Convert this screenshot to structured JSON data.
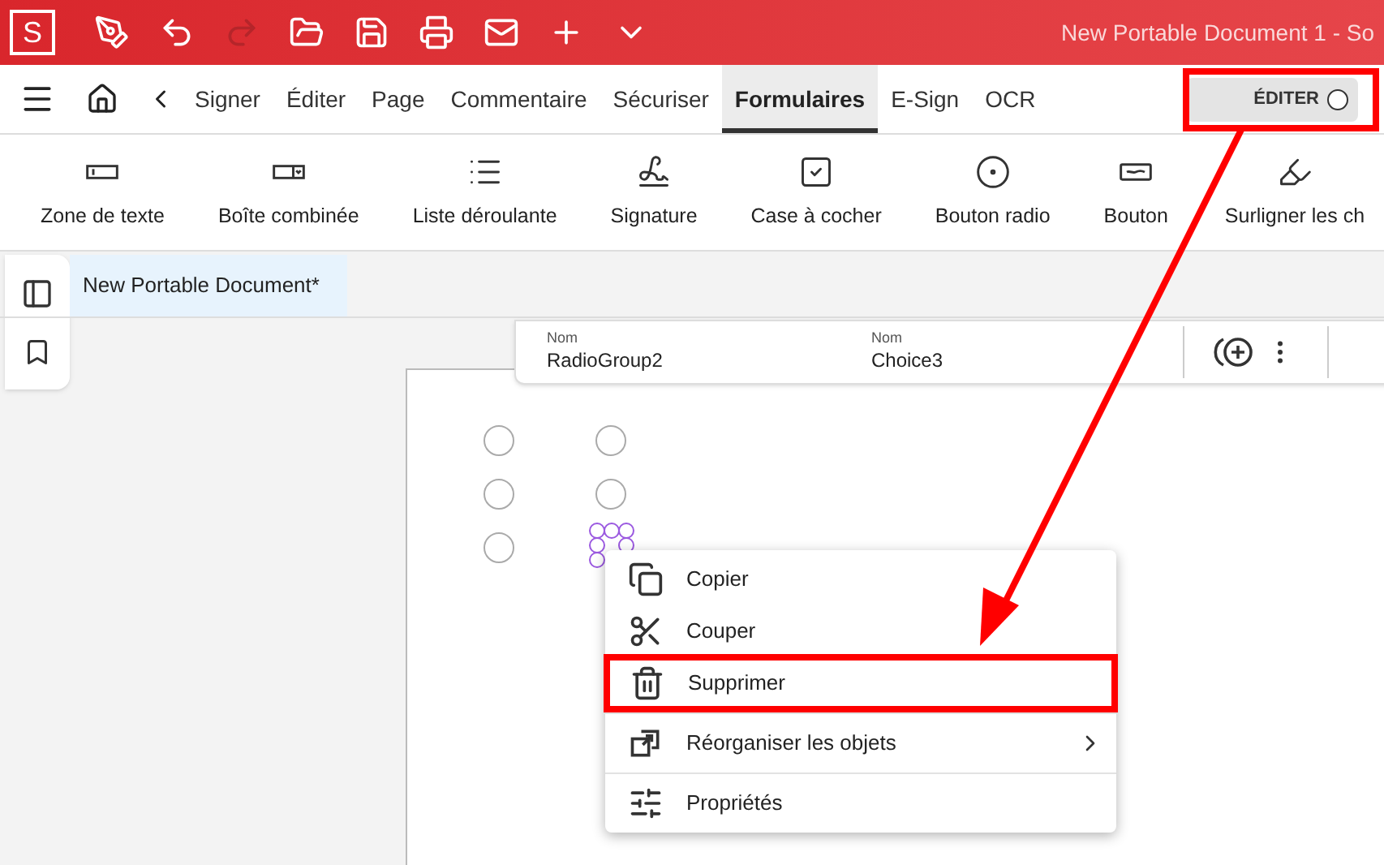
{
  "app": {
    "logo": "S",
    "title": "New Portable Document 1  -  So"
  },
  "quick_toolbar": [
    {
      "kind": "pen",
      "disabled": false
    },
    {
      "kind": "undo",
      "disabled": false
    },
    {
      "kind": "redo",
      "disabled": true
    },
    {
      "kind": "open",
      "disabled": false
    },
    {
      "kind": "save",
      "disabled": false
    },
    {
      "kind": "print",
      "disabled": false
    },
    {
      "kind": "mail",
      "disabled": false
    },
    {
      "kind": "add",
      "disabled": false
    },
    {
      "kind": "more",
      "disabled": false
    }
  ],
  "tabs": [
    {
      "label": "Signer",
      "selected": false
    },
    {
      "label": "Éditer",
      "selected": false
    },
    {
      "label": "Page",
      "selected": false
    },
    {
      "label": "Commentaire",
      "selected": false
    },
    {
      "label": "Sécuriser",
      "selected": false
    },
    {
      "label": "Formulaires",
      "selected": true
    },
    {
      "label": "E-Sign",
      "selected": false
    },
    {
      "label": "OCR",
      "selected": false
    }
  ],
  "edit_toggle": {
    "label": "ÉDITER",
    "on": false
  },
  "ribbon": [
    {
      "kind": "textfield",
      "label": "Zone de texte"
    },
    {
      "kind": "combo",
      "label": "Boîte combinée"
    },
    {
      "kind": "list",
      "label": "Liste déroulante"
    },
    {
      "kind": "signature",
      "label": "Signature"
    },
    {
      "kind": "checkbox",
      "label": "Case à cocher"
    },
    {
      "kind": "radio",
      "label": "Bouton radio"
    },
    {
      "kind": "button",
      "label": "Bouton"
    },
    {
      "kind": "highlight",
      "label": "Surligner les ch"
    }
  ],
  "document_tab": {
    "label": "New Portable Document*",
    "selected": true
  },
  "properties": [
    {
      "label": "Nom",
      "value": "RadioGroup2"
    },
    {
      "label": "Nom",
      "value": "Choice3"
    }
  ],
  "form_fields": [
    {
      "selected": false
    },
    {
      "selected": false
    },
    {
      "selected": false
    },
    {
      "selected": false
    },
    {
      "selected": false
    },
    {
      "selected": true
    }
  ],
  "context_menu": [
    {
      "kind": "copy",
      "label": "Copier",
      "highlighted": false,
      "submenu": false
    },
    {
      "kind": "cut",
      "label": "Couper",
      "highlighted": false,
      "submenu": false
    },
    {
      "kind": "delete",
      "label": "Supprimer",
      "highlighted": true,
      "submenu": false
    },
    {
      "kind": "arrange",
      "label": "Réorganiser les objets",
      "highlighted": false,
      "submenu": true
    },
    {
      "kind": "properties",
      "label": "Propriétés",
      "highlighted": false,
      "submenu": false
    }
  ]
}
